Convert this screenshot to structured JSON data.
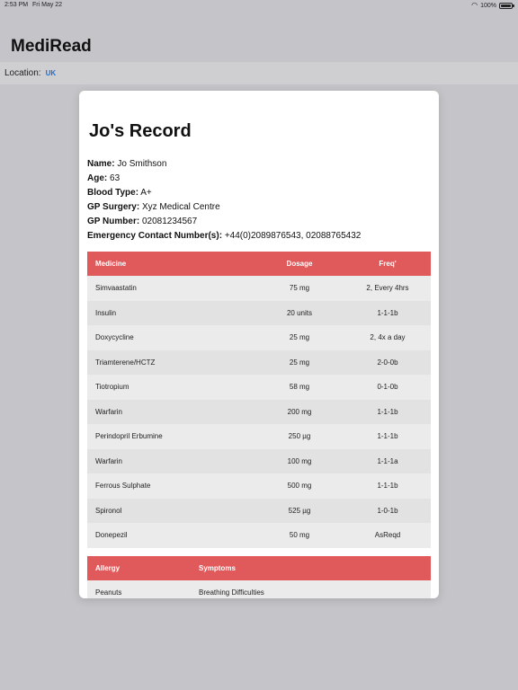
{
  "status": {
    "time": "2:53 PM",
    "date": "Fri May 22",
    "battery": "100%"
  },
  "app": {
    "title": "MediRead"
  },
  "location": {
    "label": "Location:",
    "value": "UK"
  },
  "record": {
    "title": "Jo's Record",
    "info": [
      {
        "label": "Name:",
        "value": "Jo Smithson"
      },
      {
        "label": "Age:",
        "value": "63"
      },
      {
        "label": "Blood Type:",
        "value": "A+"
      },
      {
        "label": "GP Surgery:",
        "value": "Xyz Medical Centre"
      },
      {
        "label": "GP Number:",
        "value": "02081234567"
      },
      {
        "label": "Emergency Contact Number(s):",
        "value": "+44(0)2089876543, 02088765432"
      }
    ]
  },
  "medicines": {
    "headers": {
      "medicine": "Medicine",
      "dosage": "Dosage",
      "freq": "Freq'"
    },
    "rows": [
      {
        "medicine": "Simvaastatin",
        "dosage": "75 mg",
        "freq": "2, Every 4hrs"
      },
      {
        "medicine": "Insulin",
        "dosage": "20 units",
        "freq": "1-1-1b"
      },
      {
        "medicine": "Doxycycline",
        "dosage": "25 mg",
        "freq": "2, 4x a day"
      },
      {
        "medicine": "Triamterene/HCTZ",
        "dosage": "25 mg",
        "freq": "2-0-0b"
      },
      {
        "medicine": "Tiotropium",
        "dosage": "58 mg",
        "freq": "0-1-0b"
      },
      {
        "medicine": "Warfarin",
        "dosage": "200 mg",
        "freq": "1-1-1b"
      },
      {
        "medicine": "Perindopril Erbumine",
        "dosage": "250 µg",
        "freq": "1-1-1b"
      },
      {
        "medicine": "Warfarin",
        "dosage": "100 mg",
        "freq": "1-1-1a"
      },
      {
        "medicine": "Ferrous Sulphate",
        "dosage": "500 mg",
        "freq": "1-1-1b"
      },
      {
        "medicine": "Spironol",
        "dosage": "525 µg",
        "freq": "1-0-1b"
      },
      {
        "medicine": "Donepezil",
        "dosage": "50 mg",
        "freq": "AsReqd"
      }
    ]
  },
  "allergies": {
    "headers": {
      "allergy": "Allergy",
      "symptoms": "Symptoms"
    },
    "rows": [
      {
        "allergy": "Peanuts",
        "symptoms": "Breathing Difficulties"
      }
    ]
  },
  "colors": {
    "header_red": "#e05a5b",
    "link_blue": "#1e6fd9",
    "background": "#c5c5c9"
  }
}
